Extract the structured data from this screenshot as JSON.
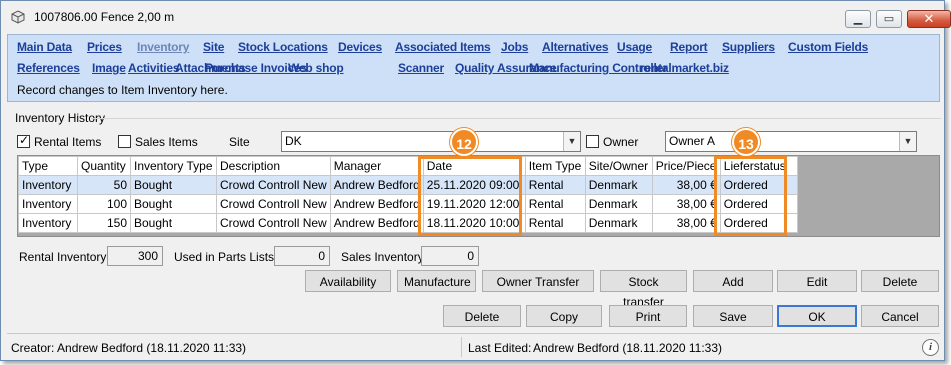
{
  "window": {
    "title": "1007806.00 Fence 2,00 m",
    "min_icon": "minimize-icon",
    "max_icon": "maximize-icon",
    "close_icon": "close-icon"
  },
  "nav": {
    "row1": [
      {
        "label": "Main Data",
        "active": false
      },
      {
        "label": "Prices",
        "active": false
      },
      {
        "label": "Inventory",
        "active": true
      },
      {
        "label": "Site",
        "active": false
      },
      {
        "label": "Stock Locations",
        "active": false
      },
      {
        "label": "Devices",
        "active": false
      },
      {
        "label": "Associated Items",
        "active": false
      },
      {
        "label": "Jobs",
        "active": false
      },
      {
        "label": "Alternatives",
        "active": false
      },
      {
        "label": "Usage",
        "active": false
      },
      {
        "label": "Report",
        "active": false
      },
      {
        "label": "Suppliers",
        "active": false
      },
      {
        "label": "Custom Fields",
        "active": false
      }
    ],
    "row2": [
      {
        "label": "References",
        "active": false
      },
      {
        "label": "Image",
        "active": false
      },
      {
        "label": "Activities",
        "active": false
      },
      {
        "label": "Attachments",
        "active": false
      },
      {
        "label": "Purchase Invoices",
        "active": false
      },
      {
        "label": "Web shop",
        "active": false
      },
      {
        "label": "Scanner",
        "active": false
      },
      {
        "label": "Quality Assurance",
        "active": false
      },
      {
        "label": "Manufacturing Controller",
        "active": false
      },
      {
        "label": "rentalmarket.biz",
        "active": false
      }
    ],
    "note": "Record changes to Item Inventory here."
  },
  "history": {
    "section_label": "Inventory History",
    "rental_items_label": "Rental Items",
    "rental_items_checked": true,
    "sales_items_label": "Sales Items",
    "sales_items_checked": false,
    "site_label": "Site",
    "site_value": "DK",
    "owner_label": "Owner",
    "owner_checked": false,
    "owner_value": "Owner A"
  },
  "grid": {
    "columns": [
      "Type",
      "Quantity",
      "Inventory Type",
      "Description",
      "Manager",
      "Date",
      "Item Type",
      "Site/Owner",
      "Price/Piece",
      "Lieferstatus"
    ],
    "rows": [
      [
        "Inventory",
        "50",
        "Bought",
        "Crowd Controll New",
        "Andrew Bedford",
        "25.11.2020 09:00",
        "Rental",
        "Denmark",
        "38,00 €",
        "Ordered"
      ],
      [
        "Inventory",
        "100",
        "Bought",
        "Crowd Controll New",
        "Andrew Bedford",
        "19.11.2020 12:00",
        "Rental",
        "Denmark",
        "38,00 €",
        "Ordered"
      ],
      [
        "Inventory",
        "150",
        "Bought",
        "Crowd Controll New",
        "Andrew Bedford",
        "18.11.2020 10:00",
        "Rental",
        "Denmark",
        "38,00 €",
        "Ordered"
      ]
    ],
    "selected_row": 0,
    "callouts": [
      "12",
      "13"
    ],
    "highlight_color": "#f08a24"
  },
  "totals": {
    "rental_label": "Rental Inventory",
    "rental_value": "300",
    "parts_label": "Used in Parts Lists",
    "parts_value": "0",
    "sales_label": "Sales Inventory",
    "sales_value": "0"
  },
  "actions": {
    "availability": "Availability",
    "manufacture": "Manufacture",
    "owner_transfer": "Owner Transfer",
    "stock_transfer": "Stock transfer",
    "add": "Add",
    "edit": "Edit",
    "delete": "Delete"
  },
  "dialog_buttons": {
    "delete": "Delete",
    "copy": "Copy",
    "print": "Print",
    "save": "Save",
    "ok": "OK",
    "cancel": "Cancel"
  },
  "status": {
    "creator": "Creator: Andrew Bedford (18.11.2020 11:33)",
    "last_edited_label": "Last Edited:",
    "last_edited_value": "Andrew Bedford (18.11.2020 11:33)",
    "info_icon": "info-icon"
  }
}
